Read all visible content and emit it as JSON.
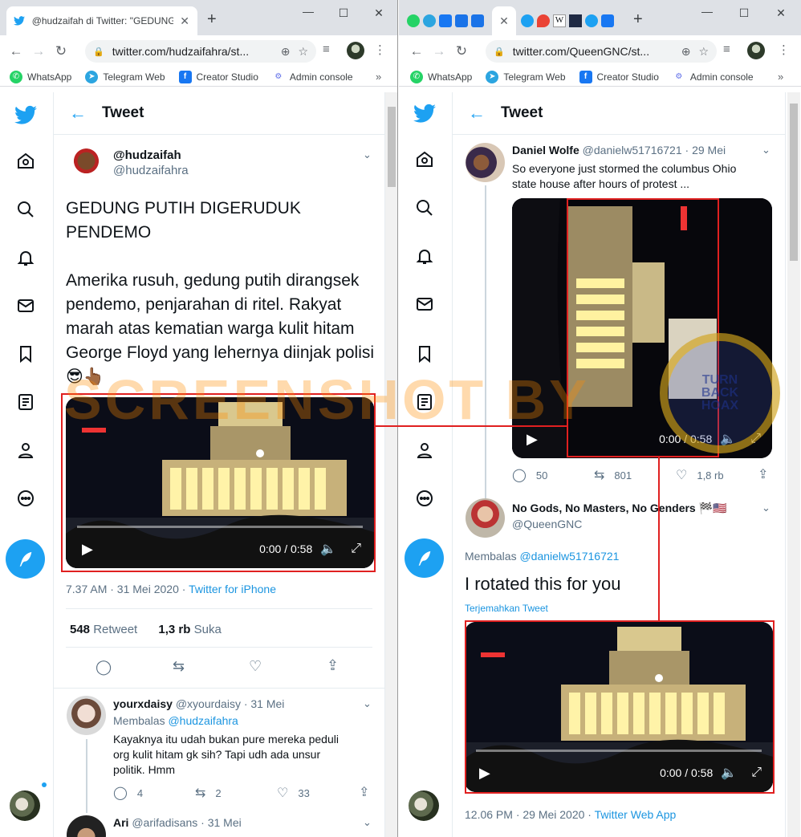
{
  "left": {
    "tab_title": "@hudzaifah di Twitter: \"GEDUNG",
    "url": "twitter.com/hudzaifahra/st...",
    "bookmarks": [
      "WhatsApp",
      "Telegram Web",
      "Creator Studio",
      "Admin console"
    ],
    "header_title": "Tweet",
    "tweet": {
      "name": "@hudzaifah",
      "handle": "@hudzaifahra",
      "text1": "GEDUNG PUTIH DIGERUDUK PENDEMO",
      "text2": "Amerika rusuh, gedung putih dirangsek pendemo, penjarahan di ritel. Rakyat marah atas kematian warga kulit hitam George Floyd yang lehernya diinjak polisi",
      "emoji": "😎👆🏾",
      "video_time": "0:00 / 0:58",
      "timestamp": "7.37 AM · 31 Mei 2020 · ",
      "source": "Twitter for iPhone",
      "retweets": "548",
      "retweets_label": " Retweet",
      "likes": "1,3 rb",
      "likes_label": " Suka"
    },
    "reply1": {
      "name": "yourxdaisy",
      "meta": "@xyourdaisy · 31 Mei",
      "replying_label": "Membalas ",
      "replying_to": "@hudzaifahra",
      "text": "Kayaknya itu udah bukan pure mereka peduli org kulit hitam gk sih? Tapi udh ada unsur politik. Hmm",
      "replies": "4",
      "retweets": "2",
      "likes": "33"
    },
    "reply2": {
      "name": "Ari",
      "meta": "@arifadisans · 31 Mei"
    }
  },
  "right": {
    "url": "twitter.com/QueenGNC/st...",
    "bookmarks": [
      "WhatsApp",
      "Telegram Web",
      "Creator Studio",
      "Admin console"
    ],
    "header_title": "Tweet",
    "tweet1": {
      "name": "Daniel Wolfe",
      "meta": "@danielw51716721 · 29 Mei",
      "text": "So everyone just stormed the columbus Ohio state house after hours of protest ...",
      "video_time": "0:00 / 0:58",
      "replies": "50",
      "retweets": "801",
      "likes": "1,8 rb"
    },
    "tweet2": {
      "name": "No Gods, No Masters, No Genders",
      "name_emoji": "🏁🇺🇸",
      "handle": "@QueenGNC",
      "replying_label": "Membalas ",
      "replying_to": "@danielw51716721",
      "text": "I rotated this for you",
      "translate": "Terjemahkan Tweet",
      "video_time": "0:00 / 0:58",
      "timestamp": "12.06 PM · 29 Mei 2020 · ",
      "source": "Twitter Web App"
    }
  },
  "watermark": {
    "text": "SCREENSHOT BY",
    "seal_lines": [
      "TURN",
      "BACK",
      "HOAX"
    ],
    "seal_ring": "MASYARAKAT ANTI FITNAH INDONESIA · MAFINDO"
  },
  "colors": {
    "twitter_blue": "#1da1f2",
    "red_annotation": "#e02020",
    "tab_bar": "#dee1e6"
  }
}
